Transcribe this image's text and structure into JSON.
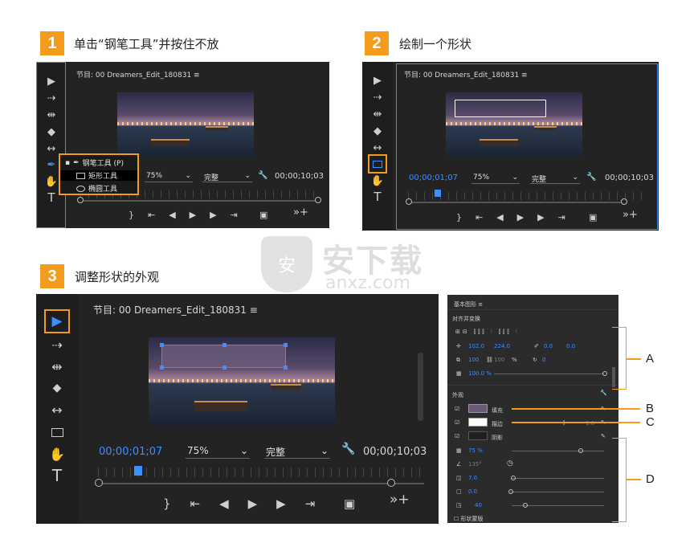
{
  "steps": [
    {
      "number": "1",
      "title": "单击“钢笔工具”并按住不放"
    },
    {
      "number": "2",
      "title": "绘制一个形状"
    },
    {
      "number": "3",
      "title": "调整形状的外观"
    }
  ],
  "monitor": {
    "title": "节目: 00 Dreamers_Edit_180831",
    "menu_icon": "hamburger-icon",
    "zoom": "75%",
    "quality": "完整",
    "duration": "00;00;10;03",
    "current_time": "00;00;01;07"
  },
  "pen_menu": {
    "items": [
      {
        "label": "钢笔工具 (P)",
        "icon": "pen-icon",
        "active": true
      },
      {
        "label": "矩形工具",
        "icon": "rectangle-icon"
      },
      {
        "label": "椭圆工具",
        "icon": "ellipse-icon"
      }
    ]
  },
  "essential_graphics": {
    "title": "基本图形",
    "section_align": "对齐并变换",
    "position_x": "102.0",
    "position_y": "224.0",
    "anchor_x": "0.0",
    "anchor_y": "0.0",
    "scale_w": "100",
    "scale_h": "100",
    "scale_unit": "%",
    "rotation": "0",
    "opacity": "100.0 %",
    "section_appearance": "外观",
    "fill_label": "填充",
    "stroke_label": "描边",
    "stroke_value": "1.0",
    "shadow_label": "阴影",
    "shadow_opacity": "75 %",
    "shadow_angle": "135°",
    "shadow_distance": "7.0",
    "shadow_size": "0.0",
    "shadow_blur": "40",
    "shape_mask": "形状蒙版",
    "fill_color": "#6b5a7a",
    "stroke_color": "#ffffff"
  },
  "callouts": [
    "A",
    "B",
    "C",
    "D"
  ],
  "watermark": {
    "cn": "安下载",
    "url": "anxz.com",
    "badge": "安"
  },
  "colors": {
    "accent": "#f39b1c",
    "selection": "#3b8fff",
    "panel": "#232323"
  }
}
